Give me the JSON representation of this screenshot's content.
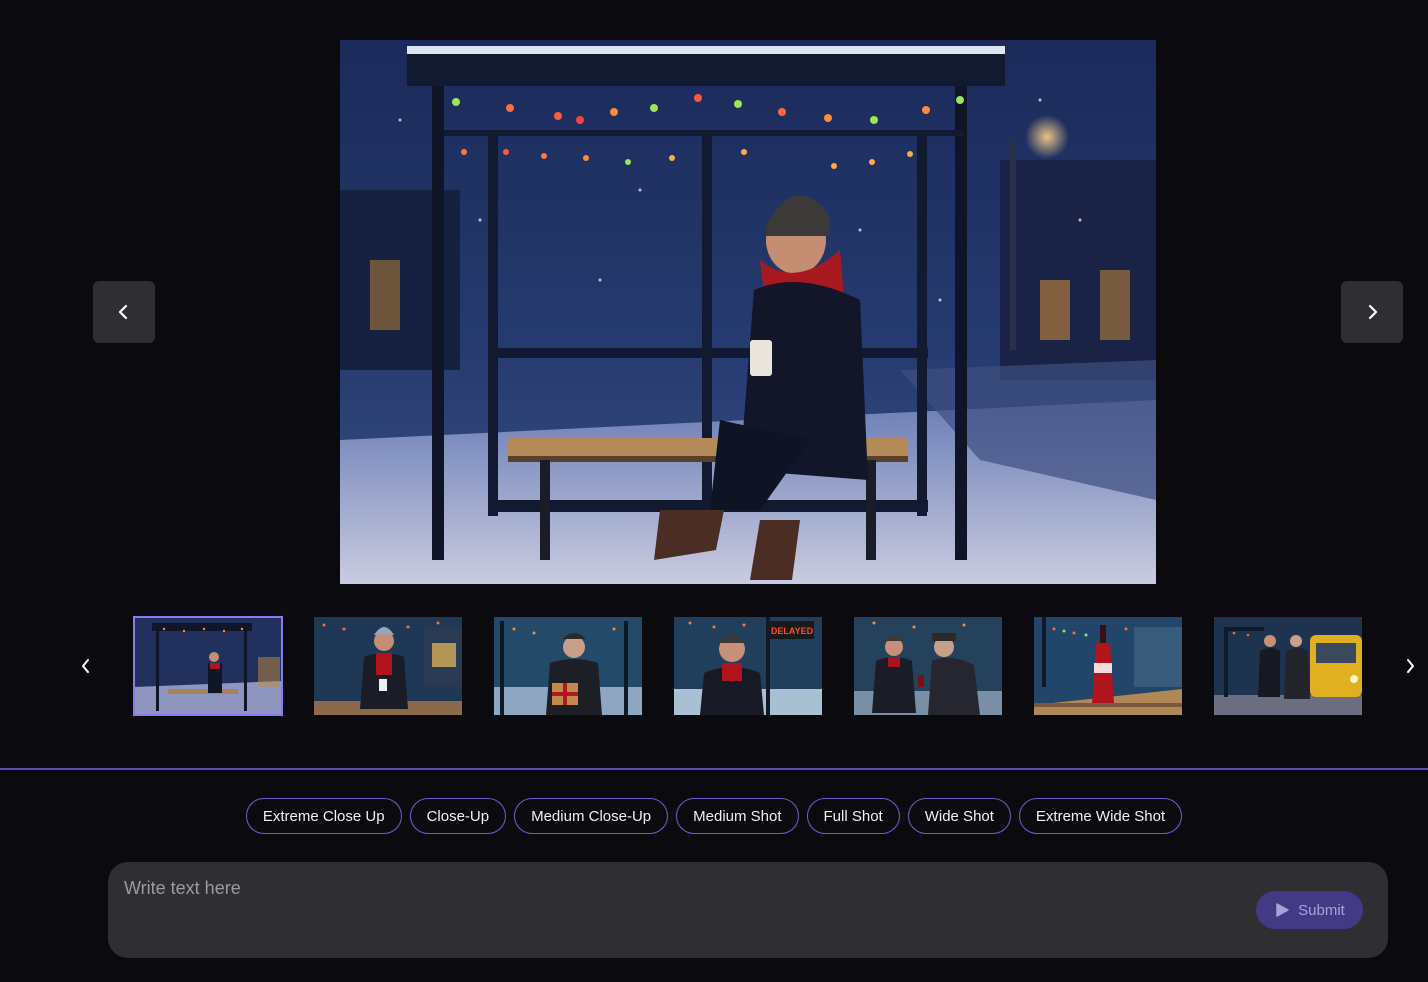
{
  "viewer": {
    "prev_icon": "chevron-left-icon",
    "next_icon": "chevron-right-icon"
  },
  "thumbnails": {
    "count": 7,
    "selected_index": 0,
    "items": [
      {
        "scene": "woman-seated-bus-shelter-wide"
      },
      {
        "scene": "woman-seated-with-cup-medium"
      },
      {
        "scene": "old-man-holding-gift"
      },
      {
        "scene": "woman-closeup-delayed-sign",
        "sign_text": "DELAYED"
      },
      {
        "scene": "woman-and-old-man-talking"
      },
      {
        "scene": "soda-bottle-on-bench"
      },
      {
        "scene": "couple-and-yellow-bus"
      }
    ]
  },
  "shot_types": [
    "Extreme Close Up",
    "Close-Up",
    "Medium Close-Up",
    "Medium Shot",
    "Full Shot",
    "Wide Shot",
    "Extreme Wide Shot"
  ],
  "composer": {
    "placeholder": "Write text here",
    "submit_label": "Submit",
    "submit_icon": "play-icon"
  },
  "colors": {
    "accent": "#6b5fd0",
    "selected_outline": "#8a7cf0",
    "panel": "#2e2e33",
    "background": "#0b0b0f"
  }
}
